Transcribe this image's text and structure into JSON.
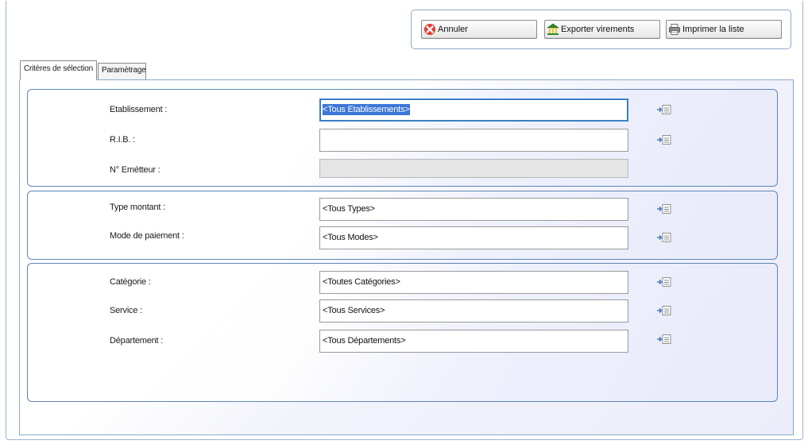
{
  "toolbar": {
    "cancel_label": "Annuler",
    "export_label": "Exporter virements",
    "print_label": "Imprimer la liste"
  },
  "tabs": {
    "criteres_label": "Critères de sélection",
    "param_label": "Paramètrage"
  },
  "form": {
    "etablissement_label": "Etablissement :",
    "etablissement_value": "<Tous Etablissements>",
    "rib_label": "R.I.B. :",
    "rib_value": "",
    "emetteur_label": "N° Emétteur :",
    "emetteur_value": "",
    "type_montant_label": "Type montant :",
    "type_montant_value": "<Tous Types>",
    "mode_paiement_label": "Mode de paiement :",
    "mode_paiement_value": "<Tous Modes>",
    "categorie_label": "Catégorie :",
    "categorie_value": "<Toutes Catégories>",
    "service_label": "Service :",
    "service_value": "<Tous Services>",
    "departement_label": "Département :",
    "departement_value": "<Tous Départements>"
  },
  "icons": {
    "cancel": "red-x-icon",
    "export": "bank-icon",
    "print": "printer-icon",
    "picker": "list-picker-icon"
  },
  "colors": {
    "focus_border": "#3b7fc4",
    "selection": "#3a76d6",
    "group_border": "#5d86b8"
  }
}
